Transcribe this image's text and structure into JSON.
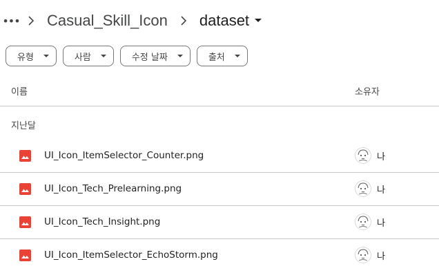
{
  "breadcrumb": {
    "more_label": "•••",
    "parent": "Casual_Skill_Icon",
    "current": "dataset"
  },
  "filters": [
    {
      "label": "유형"
    },
    {
      "label": "사람"
    },
    {
      "label": "수정 날짜"
    },
    {
      "label": "출처"
    }
  ],
  "columns": {
    "name": "이름",
    "owner": "소유자"
  },
  "group": {
    "label": "지난달"
  },
  "files": [
    {
      "name": "UI_Icon_ItemSelector_Counter.png",
      "owner": "나",
      "icon": "image-file-icon"
    },
    {
      "name": "UI_Icon_Tech_Prelearning.png",
      "owner": "나",
      "icon": "image-file-icon"
    },
    {
      "name": "UI_Icon_Tech_Insight.png",
      "owner": "나",
      "icon": "image-file-icon"
    },
    {
      "name": "UI_Icon_ItemSelector_EchoStorm.png",
      "owner": "나",
      "icon": "image-file-icon"
    }
  ],
  "colors": {
    "image_icon": "#ea4335",
    "text_primary": "#1f1f1f",
    "text_secondary": "#444746",
    "divider": "#c4c7c5"
  }
}
